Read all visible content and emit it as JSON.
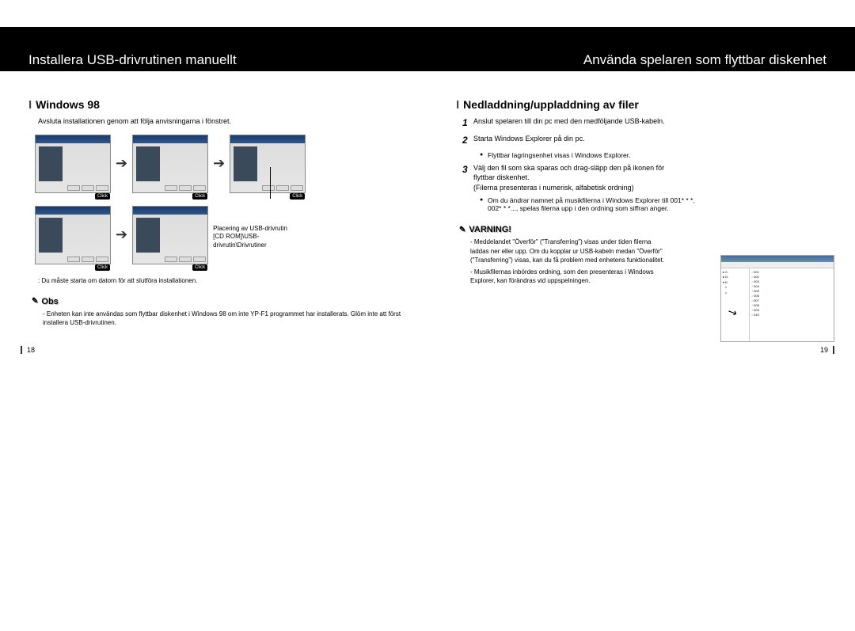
{
  "left": {
    "title": "Installera USB-drivrutinen manuellt",
    "heading": "Windows 98",
    "intro": "Avsluta installationen genom att följa anvisningarna i fönstret.",
    "click_label": "Click",
    "caption_line1": "Placering av USB-drivrutin",
    "caption_line2": "[CD ROM]\\USB-drivrutin\\Drivrutiner",
    "restart_note": ": Du måste starta om datorn för att slutföra installationen.",
    "obs_head": "Obs",
    "obs_text": "- Enheten kan inte användas som flyttbar diskenhet i Windows 98 om inte YP-F1 programmet har installerats. Glöm inte att först installera USB-drivrutinen.",
    "page_num": "18"
  },
  "right": {
    "title": "Använda spelaren som flyttbar diskenhet",
    "heading": "Nedladdning/uppladdning av filer",
    "steps": [
      "Anslut spelaren till din pc med den medföljande USB-kabeln.",
      "Starta Windows Explorer på din pc.",
      "Välj den fil som ska sparas och drag-släpp den på ikonen för flyttbar diskenhet."
    ],
    "sub2": "Flyttbar lagringsenhet visas i Windows Explorer.",
    "sub3a": "(Filerna presenteras i numerisk, alfabetisk ordning)",
    "sub3b": "Om du ändrar namnet på musikfilerna i Windows Explorer till 001* * *, 002* * *..., spelas filerna upp i den ordning som siffran anger.",
    "warn_head": "VARNING!",
    "warn_text1": "- Meddelandet \"Överför\" (\"Transferring\") visas under tiden filerna laddas ner eller upp. Om du kopplar ur USB-kabeln medan \"Överför\" (\"Transferring\") visas, kan du få problem med enhetens funktionalitet.",
    "warn_text2": "- Musikfilernas inbördes ordning, som den presenteras i Windows Explorer, kan förändras vid uppspelningen.",
    "page_num": "19"
  }
}
